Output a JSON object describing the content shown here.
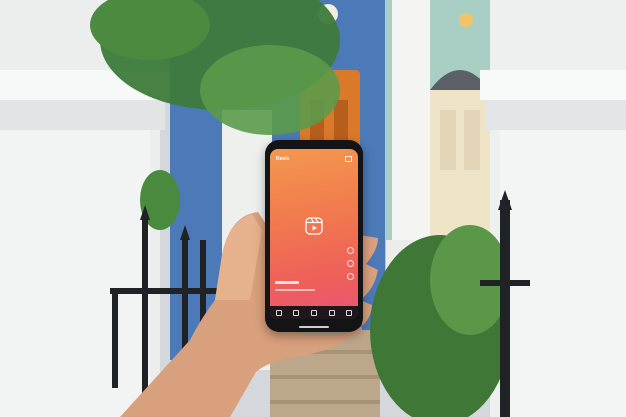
{
  "scene": {
    "description_icons": [
      "reels-icon",
      "camera-icon",
      "home-icon",
      "search-icon",
      "add-icon",
      "shop-icon",
      "profile-icon"
    ],
    "phone_screen": {
      "title": "Reels"
    },
    "colors": {
      "gradient_top": "#f4984f",
      "gradient_bottom": "#e85577",
      "door_orange": "#d9792a",
      "wall_blue": "#4c79b8",
      "wall_mint": "#a9cfc4"
    }
  }
}
